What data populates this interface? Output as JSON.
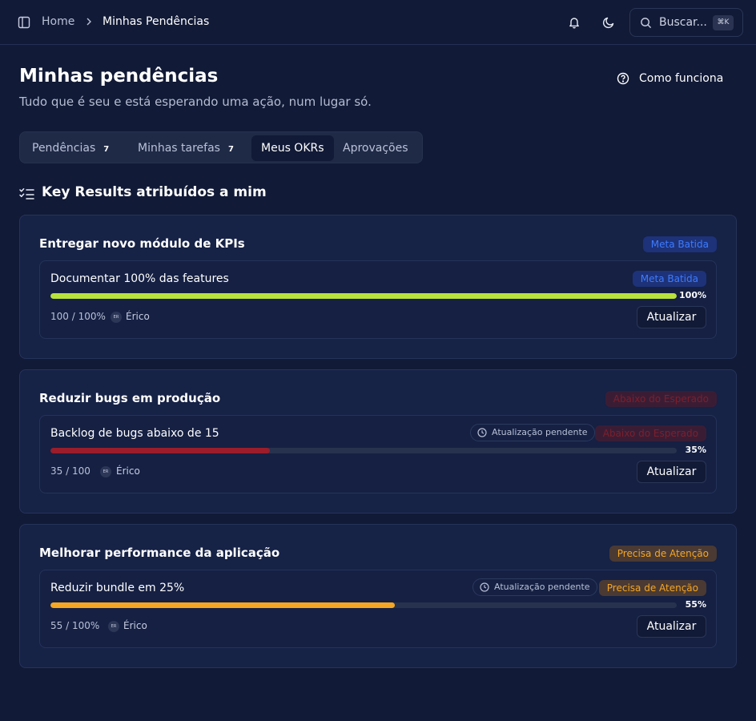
{
  "topbar": {
    "breadcrumb": [
      "Home",
      "Minhas Pendências"
    ],
    "search": {
      "label": "Buscar...",
      "shortcut": "⌘K"
    }
  },
  "header": {
    "title": "Minhas pendências",
    "subtitle": "Tudo que é seu e está esperando uma ação, num lugar só.",
    "help_label": "Como funciona"
  },
  "tabs": [
    {
      "label": "Pendências",
      "count": "7"
    },
    {
      "label": "Minhas tarefas",
      "count": "7"
    },
    {
      "label": "Meus OKRs",
      "active": true
    },
    {
      "label": "Aprovações"
    }
  ],
  "section": {
    "title": "Key Results atribuídos a mim"
  },
  "update_label": "Atualizar",
  "pending_label": "Atualização pendente",
  "objectives": [
    {
      "title": "Entregar novo módulo de KPIs",
      "status": "Meta Batida",
      "status_color": "#3e7bff",
      "key_results": [
        {
          "title": "Documentar 100% das features",
          "status": "Meta Batida",
          "progress_pct": 100,
          "progress_label": "100%",
          "value": "100 / 100%",
          "owner_initials": "ER",
          "owner": "Érico",
          "pending": false,
          "bar_color": "#b9e23b"
        }
      ]
    },
    {
      "title": "Reduzir bugs em produção",
      "status": "Abaixo do Esperado",
      "status_color": "#7e1f2c",
      "key_results": [
        {
          "title": "Backlog de bugs abaixo de 15",
          "status": "Abaixo do Esperado",
          "progress_pct": 35,
          "progress_label": "35%",
          "value": "35 / 100",
          "owner_initials": "ER",
          "owner": "Érico",
          "pending": true,
          "bar_color": "#9b1c2a"
        }
      ]
    },
    {
      "title": "Melhorar performance da aplicação",
      "status": "Precisa de Atenção",
      "status_color": "#f5a623",
      "key_results": [
        {
          "title": "Reduzir bundle em 25%",
          "status": "Precisa de Atenção",
          "progress_pct": 55,
          "progress_label": "55%",
          "value": "55 / 100%",
          "owner_initials": "ER",
          "owner": "Érico",
          "pending": true,
          "bar_color": "#f5a623"
        }
      ]
    }
  ]
}
